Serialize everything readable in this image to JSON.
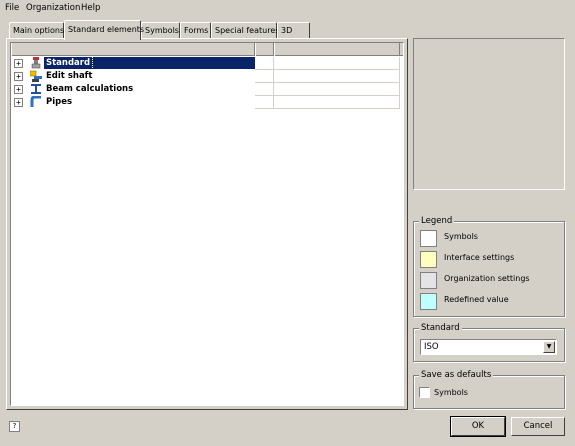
{
  "menu": [
    "File",
    "Organization",
    "Help"
  ],
  "tabs": [
    {
      "label": "Main options",
      "active": false
    },
    {
      "label": "Standard elements",
      "active": true
    },
    {
      "label": "Symbols",
      "active": false
    },
    {
      "label": "Forms",
      "active": false
    },
    {
      "label": "Special features",
      "active": false
    },
    {
      "label": "3D",
      "active": false
    }
  ],
  "tree": {
    "nodes": [
      {
        "label": "Standard",
        "expander": "+",
        "icon": "standard-icon",
        "selected": true
      },
      {
        "label": "Edit shaft",
        "expander": "+",
        "icon": "edit-shaft-icon",
        "selected": false
      },
      {
        "label": "Beam calculations",
        "expander": "+",
        "icon": "beam-icon",
        "selected": false
      },
      {
        "label": "Pipes",
        "expander": "+",
        "icon": "pipes-icon",
        "selected": false
      }
    ]
  },
  "legend": {
    "title": "Legend",
    "items": [
      {
        "label": "Symbols",
        "color": "#ffffff"
      },
      {
        "label": "Interface settings",
        "color": "#ffffc0"
      },
      {
        "label": "Organization settings",
        "color": "#e4e4e4"
      },
      {
        "label": "Redefined value",
        "color": "#c0ffff"
      }
    ]
  },
  "standard": {
    "title": "Standard",
    "value": "ISO"
  },
  "save_defaults": {
    "title": "Save as defaults",
    "checkbox_label": "Symbols",
    "checked": false
  },
  "buttons": {
    "ok": "OK",
    "cancel": "Cancel"
  },
  "help_icon_glyph": "?"
}
